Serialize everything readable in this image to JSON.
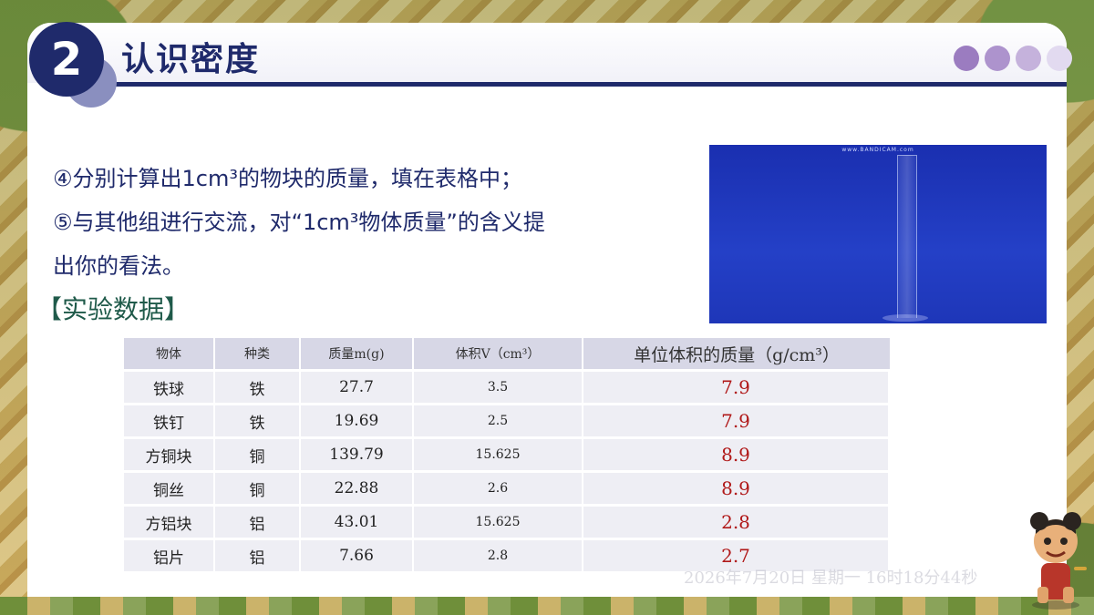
{
  "header": {
    "section_number": "2",
    "title": "认识密度"
  },
  "colors": {
    "navy": "#1f2a6b",
    "dots": [
      "#9b7cc0",
      "#ad93cd",
      "#c5b2dc",
      "#e2daf0"
    ],
    "density_value": "#b01818"
  },
  "body": {
    "lines": [
      "④分别计算出1cm³的物块的质量，填在表格中；",
      "⑤与其他组进行交流，对“1cm³物体质量”的含义提",
      "出你的看法。"
    ],
    "section_label": "【实验数据】"
  },
  "video": {
    "watermark": "www.BANDICAM.com"
  },
  "table": {
    "headers": [
      "物体",
      "种类",
      "质量m(g)",
      "体积V（cm³）",
      "单位体积的质量（g/cm³）"
    ],
    "rows": [
      [
        "铁球",
        "铁",
        "27.7",
        "3.5",
        "7.9"
      ],
      [
        "铁钉",
        "铁",
        "19.69",
        "2.5",
        "7.9"
      ],
      [
        "方铜块",
        "铜",
        "139.79",
        "15.625",
        "8.9"
      ],
      [
        "铜丝",
        "铜",
        "22.88",
        "2.6",
        "8.9"
      ],
      [
        "方铝块",
        "铝",
        "43.01",
        "15.625",
        "2.8"
      ],
      [
        "铝片",
        "铝",
        "7.66",
        "2.8",
        "2.7"
      ]
    ]
  },
  "timestamp": "2026年7月20日 星期一 16时18分44秒",
  "icons": [
    "mascot-icon"
  ]
}
